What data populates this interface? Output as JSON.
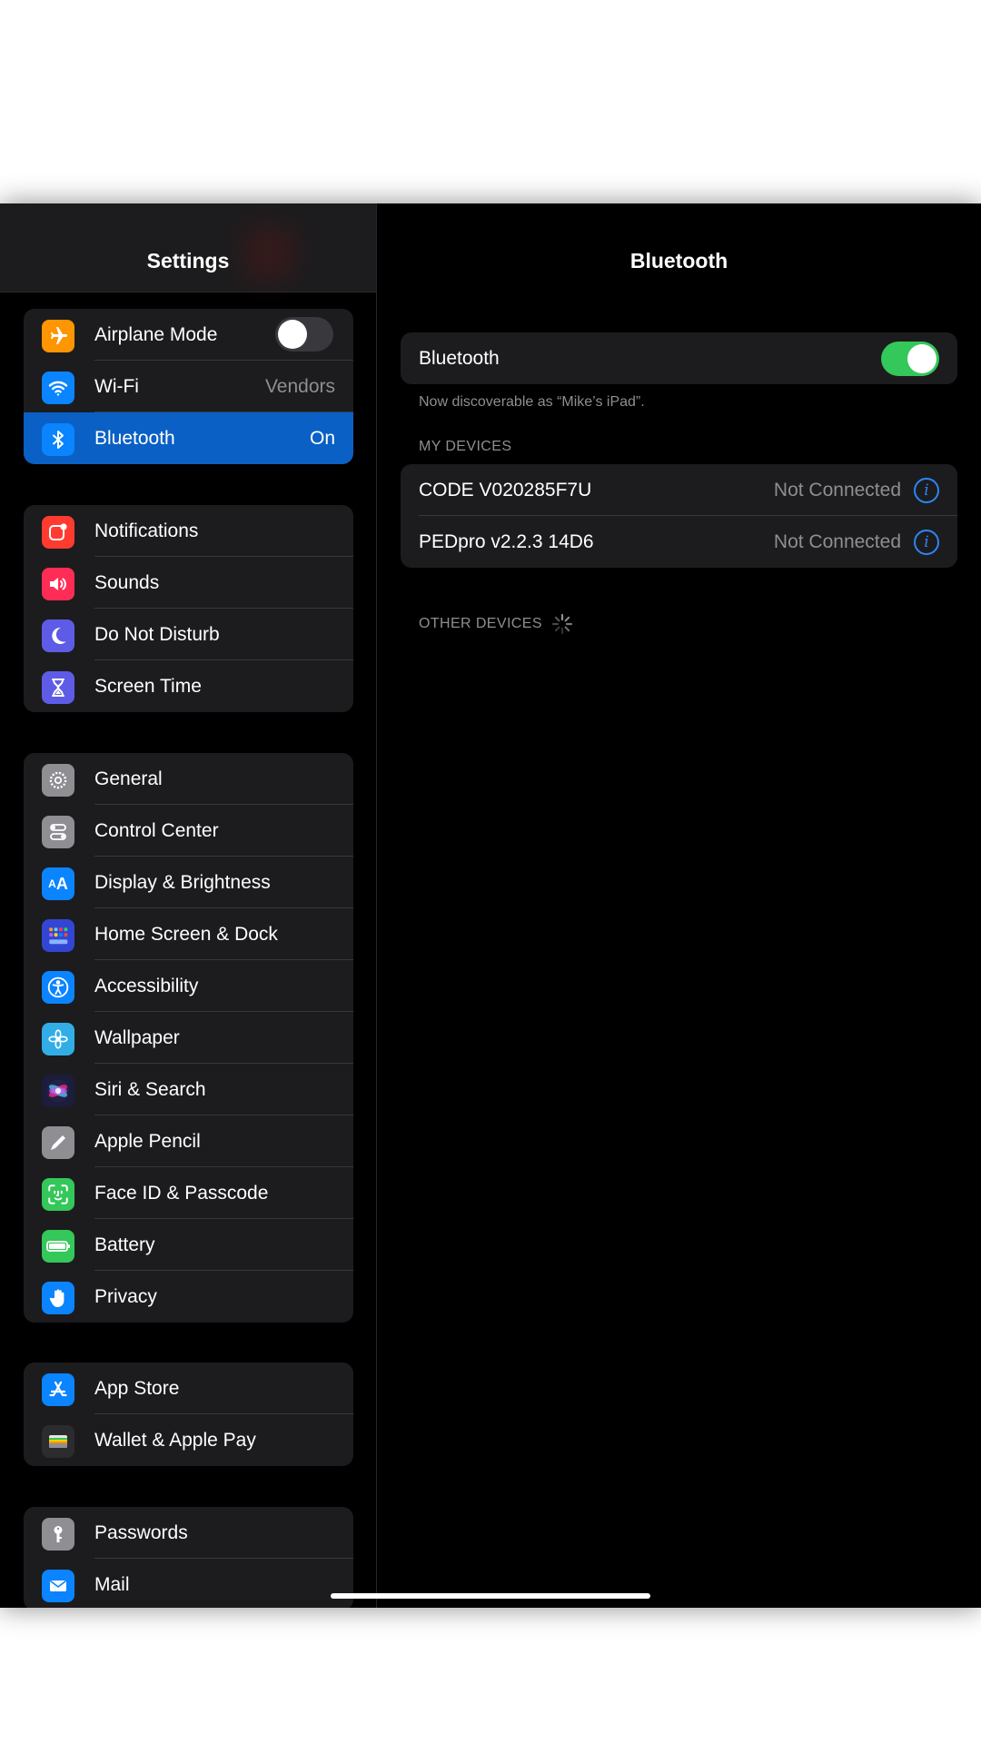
{
  "sidebar": {
    "title": "Settings",
    "groups": [
      {
        "items": [
          {
            "label": "Airplane Mode",
            "value": "",
            "icon": "airplane-icon",
            "color": "#ff9500"
          },
          {
            "label": "Wi-Fi",
            "value": "Vendors",
            "icon": "wifi-icon",
            "color": "#0a84ff"
          },
          {
            "label": "Bluetooth",
            "value": "On",
            "icon": "bluetooth-icon",
            "color": "#0a84ff"
          }
        ]
      },
      {
        "items": [
          {
            "label": "Notifications",
            "icon": "notifications-icon",
            "color": "#ff3b30"
          },
          {
            "label": "Sounds",
            "icon": "sounds-icon",
            "color": "#ff2d55"
          },
          {
            "label": "Do Not Disturb",
            "icon": "moon-icon",
            "color": "#5e5ce6"
          },
          {
            "label": "Screen Time",
            "icon": "hourglass-icon",
            "color": "#5e5ce6"
          }
        ]
      },
      {
        "items": [
          {
            "label": "General",
            "icon": "gear-icon",
            "color": "#8e8e93"
          },
          {
            "label": "Control Center",
            "icon": "toggles-icon",
            "color": "#8e8e93"
          },
          {
            "label": "Display & Brightness",
            "icon": "text-size-icon",
            "color": "#0a84ff"
          },
          {
            "label": "Home Screen & Dock",
            "icon": "grid-icon",
            "color": "#3246d3"
          },
          {
            "label": "Accessibility",
            "icon": "accessibility-icon",
            "color": "#0a84ff"
          },
          {
            "label": "Wallpaper",
            "icon": "flower-icon",
            "color": "#32ade6"
          },
          {
            "label": "Siri & Search",
            "icon": "siri-icon",
            "color": "#1c1c3c"
          },
          {
            "label": "Apple Pencil",
            "icon": "pencil-icon",
            "color": "#8e8e93"
          },
          {
            "label": "Face ID & Passcode",
            "icon": "face-id-icon",
            "color": "#34c759"
          },
          {
            "label": "Battery",
            "icon": "battery-icon",
            "color": "#34c759"
          },
          {
            "label": "Privacy",
            "icon": "hand-icon",
            "color": "#0a84ff"
          }
        ]
      },
      {
        "items": [
          {
            "label": "App Store",
            "icon": "app-store-icon",
            "color": "#0a84ff"
          },
          {
            "label": "Wallet & Apple Pay",
            "icon": "wallet-icon",
            "color": "#2c2c2e"
          }
        ]
      },
      {
        "items": [
          {
            "label": "Passwords",
            "icon": "key-icon",
            "color": "#8e8e93"
          },
          {
            "label": "Mail",
            "icon": "mail-icon",
            "color": "#0a84ff"
          }
        ]
      }
    ],
    "airplane_mode_on": false
  },
  "detail": {
    "title": "Bluetooth",
    "bluetooth_label": "Bluetooth",
    "bluetooth_on": true,
    "discoverable_note": "Now discoverable as “Mike’s iPad”.",
    "my_devices_header": "MY DEVICES",
    "devices": [
      {
        "name": "CODE V020285F7U",
        "status": "Not Connected"
      },
      {
        "name": "PEDpro v2.2.3 14D6",
        "status": "Not Connected"
      }
    ],
    "other_devices_header": "OTHER DEVICES",
    "info_glyph": "i"
  },
  "colors": {
    "accent": "#0a84ff",
    "selected_row": "#0a60c4",
    "toggle_on": "#34c759",
    "toggle_off": "#39393d",
    "info": "#2b86f5"
  }
}
